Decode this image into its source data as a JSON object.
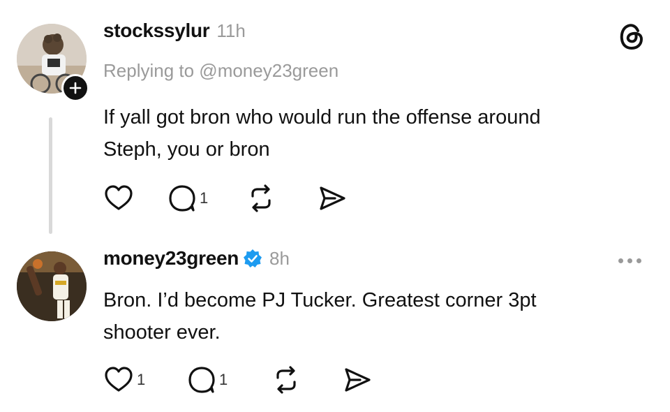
{
  "posts": [
    {
      "username": "stockssylur",
      "time": "11h",
      "replying_to": "Replying to @money23green",
      "text_line1": "If yall got bron who would run the offense around",
      "text_line2": "Steph, you or bron",
      "likes": "",
      "replies": "1",
      "avatar_icon": "person-avatar",
      "follow_icon": "plus-icon"
    },
    {
      "username": "money23green",
      "verified": true,
      "time": "8h",
      "text_line1": "Bron. I’d become PJ Tucker. Greatest corner 3pt",
      "text_line2": "shooter ever.",
      "likes": "1",
      "replies": "1",
      "avatar_icon": "person-avatar"
    }
  ],
  "colors": {
    "text": "#111111",
    "muted": "#9a9a9a",
    "verified": "#1d9bf0",
    "thread_line": "#d9d9d9"
  },
  "icons": [
    "threads-logo-icon",
    "heart-icon",
    "comment-icon",
    "repost-icon",
    "share-icon",
    "more-icon",
    "verified-icon",
    "plus-icon"
  ]
}
